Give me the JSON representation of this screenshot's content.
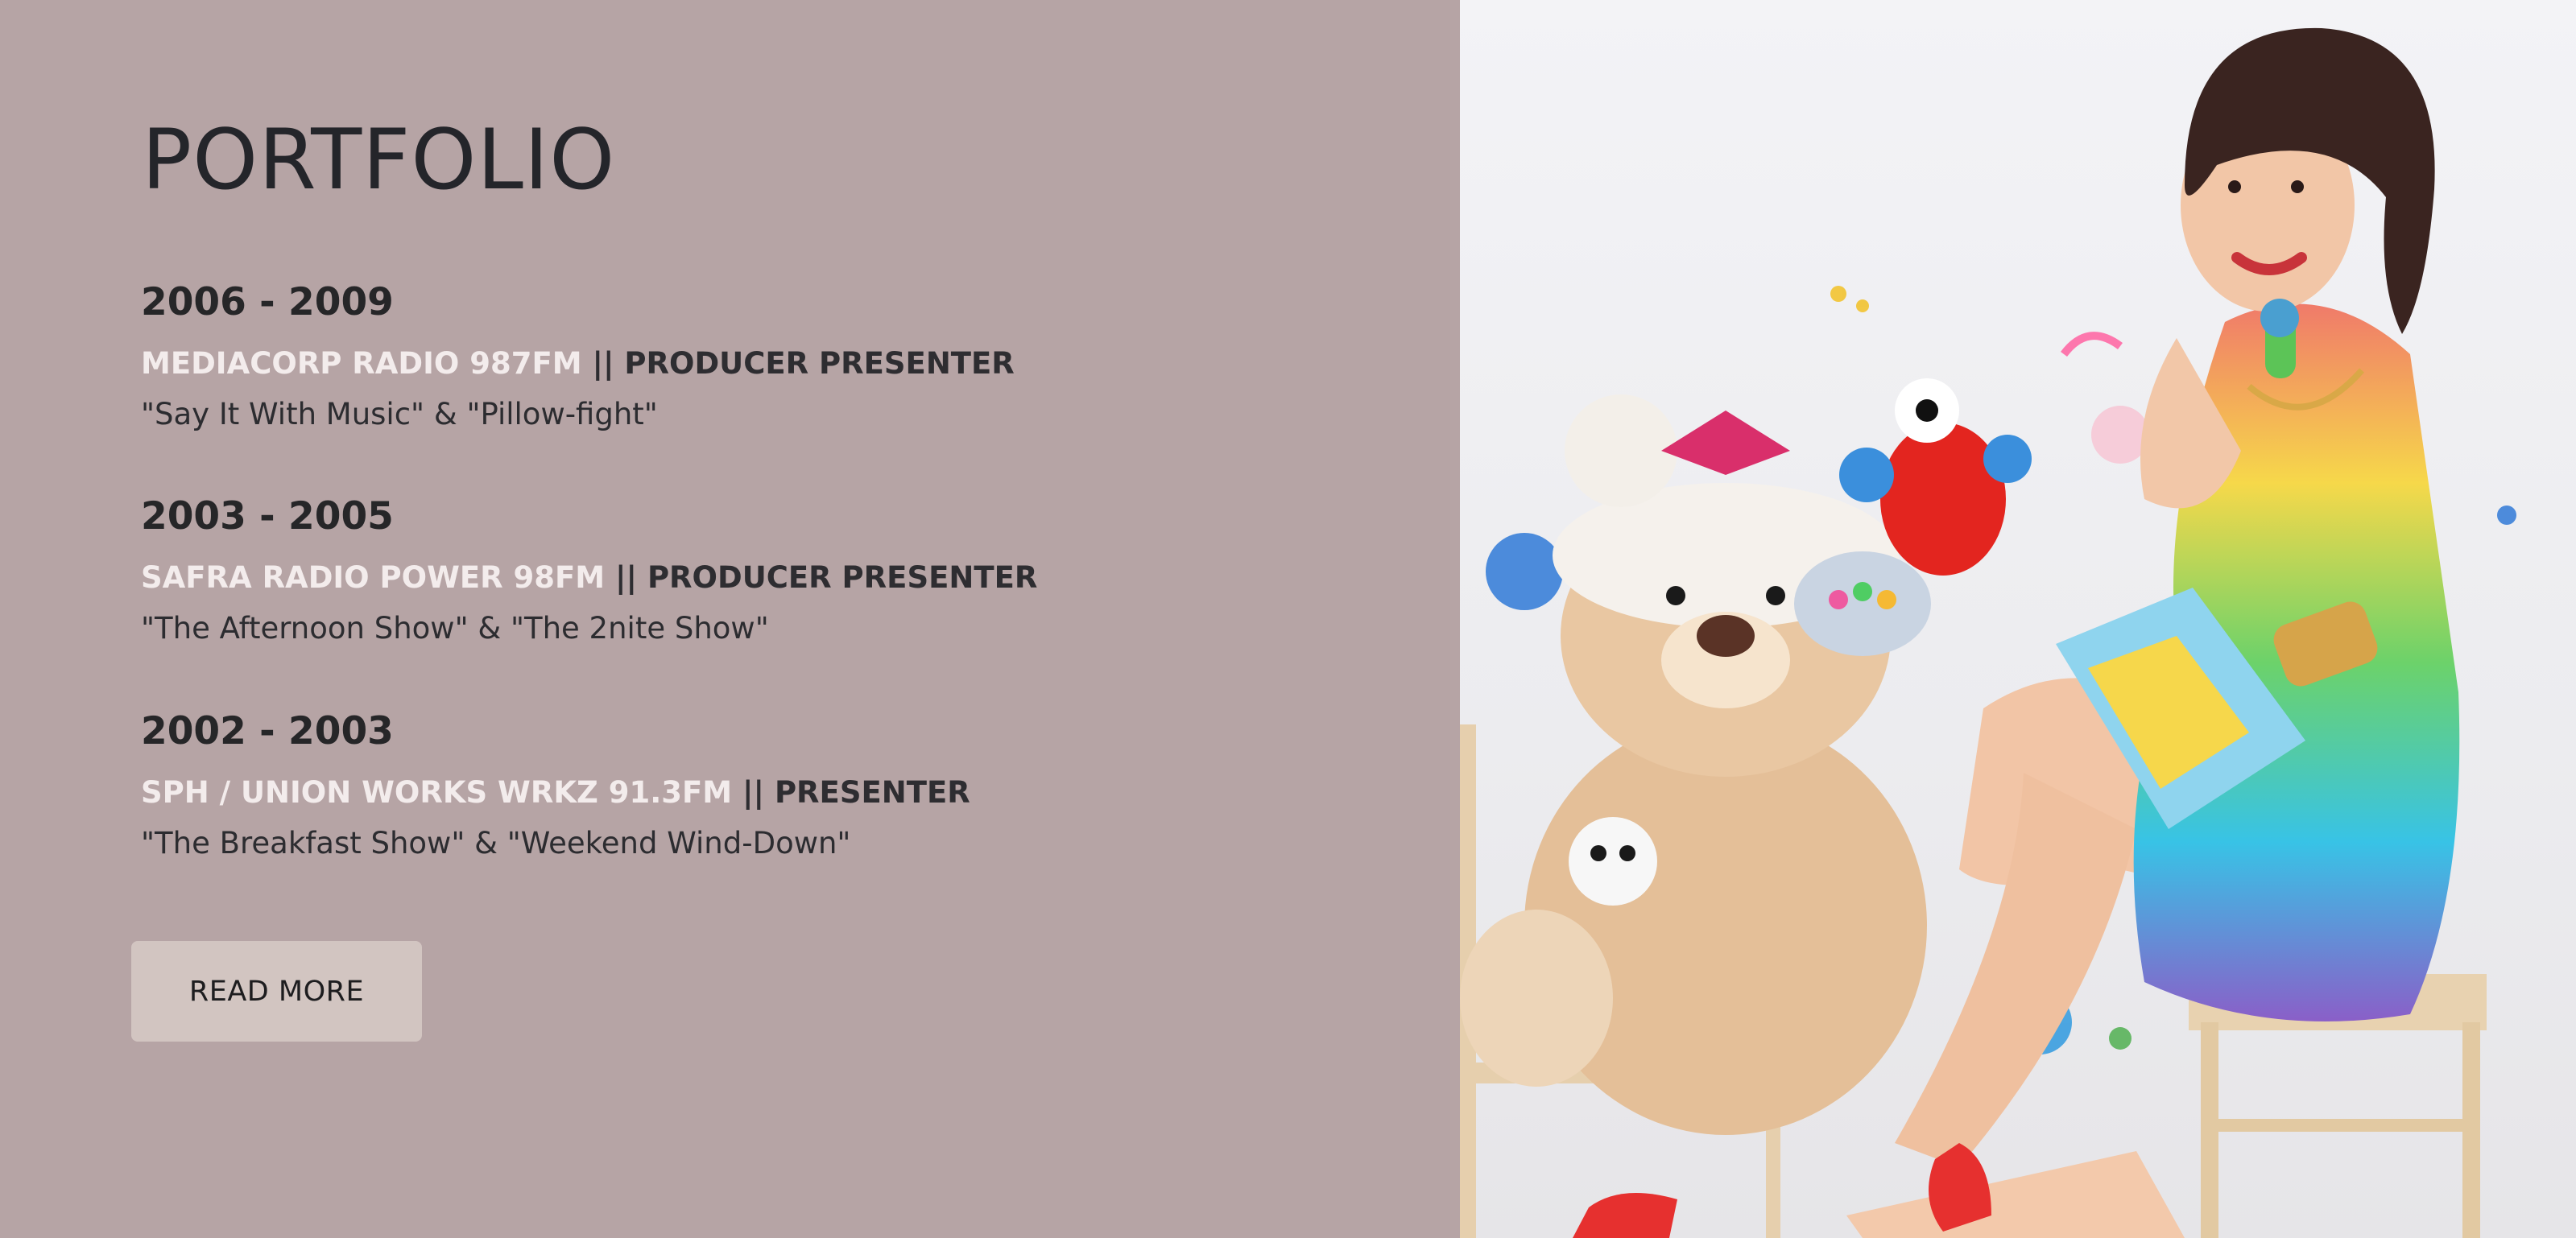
{
  "portfolio": {
    "title": "PORTFOLIO",
    "entries": [
      {
        "years": "2006 - 2009",
        "employer": "MEDIACORP RADIO 987FM",
        "separator": "||",
        "role": "PRODUCER PRESENTER",
        "shows": "\"Say It With Music\" & \"Pillow-fight\""
      },
      {
        "years": "2003 - 2005",
        "employer": "SAFRA RADIO POWER 98FM",
        "separator": "||",
        "role": "PRODUCER PRESENTER",
        "shows": "\"The Afternoon Show\" & \"The 2nite Show\""
      },
      {
        "years": "2002 - 2003",
        "employer": "SPH / UNION WORKS WRKZ 91.3FM",
        "separator": "||",
        "role": "PRESENTER",
        "shows": "\"The Breakfast Show\" & \"Weekend Wind-Down\""
      }
    ],
    "read_more_label": "READ MORE"
  },
  "colors": {
    "panel_background": "#b6a4a5",
    "button_background": "#d2c5c1",
    "heading_text": "#24252a",
    "employer_text": "#f3ecec"
  }
}
